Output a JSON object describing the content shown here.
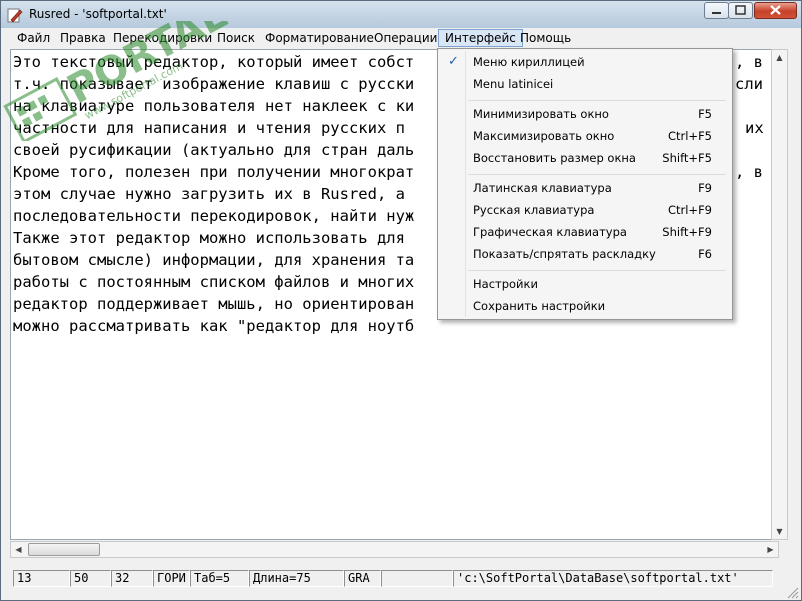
{
  "window": {
    "title": "Rusred - 'softportal.txt'"
  },
  "menubar": {
    "items": [
      {
        "label": "Файл"
      },
      {
        "label": "Правка"
      },
      {
        "label": "Перекодировки"
      },
      {
        "label": "Поиск"
      },
      {
        "label": "Форматирование"
      },
      {
        "label": "Операции"
      },
      {
        "label": "Интерфейс"
      },
      {
        "label": "Помощь"
      }
    ]
  },
  "editor": {
    "lines": [
      "Это текстовый редактор, который имеет собст",
      "т.ч. показывает изображение клавиш с русски",
      "на клавиатуре пользователя нет наклеек с ки",
      "частности для написания и чтения русских п",
      "своей русификации (актуально для стран даль",
      "Кроме того, полезен при получении многократ",
      "этом случае нужно загрузить их в Rusred, а ",
      "последовательности перекодировок, найти нуж",
      "Также этот редактор можно использовать для",
      "бытовом смысле) информации, для хранения та",
      "работы с постоянным списком файлов и многих",
      "редактор поддерживает мышь, но ориентирован",
      "можно рассматривать как \"редактор для ноутб"
    ],
    "right_edge": [
      ", в",
      "сли",
      "",
      "их",
      "",
      ", в",
      "",
      "",
      "",
      "",
      "",
      "",
      ""
    ]
  },
  "dropdown": {
    "groups": [
      [
        {
          "label": "Меню кириллицей",
          "shortcut": "",
          "checked": true
        },
        {
          "label": "Menu latinicei",
          "shortcut": "",
          "checked": false
        }
      ],
      [
        {
          "label": "Минимизировать окно",
          "shortcut": "F5"
        },
        {
          "label": "Максимизировать окно",
          "shortcut": "Ctrl+F5"
        },
        {
          "label": "Восстановить размер окна",
          "shortcut": "Shift+F5"
        }
      ],
      [
        {
          "label": "Латинская клавиатура",
          "shortcut": "F9"
        },
        {
          "label": "Русская клавиатура",
          "shortcut": "Ctrl+F9"
        },
        {
          "label": "Графическая клавиатура",
          "shortcut": "Shift+F9"
        },
        {
          "label": "Показать/спрятать раскладку",
          "shortcut": "F6"
        }
      ],
      [
        {
          "label": "Настройки",
          "shortcut": ""
        },
        {
          "label": "Сохранить настройки",
          "shortcut": ""
        }
      ]
    ],
    "check_glyph": "✓"
  },
  "statusbar": {
    "cells": [
      "13",
      "50",
      "32",
      "ГОРИ",
      "Таб=5",
      "Длина=75",
      "GRA",
      "",
      "'c:\\SoftPortal\\DataBase\\softportal.txt'"
    ]
  },
  "watermark": {
    "brand": "PORTAL",
    "url": "www.softportal.com",
    "tm": "TM"
  },
  "colors": {
    "menu_active_bg": "#d8e6f5",
    "menu_active_border": "#7da2ce",
    "check": "#1e5fb3",
    "close_button": "#c7402a"
  }
}
